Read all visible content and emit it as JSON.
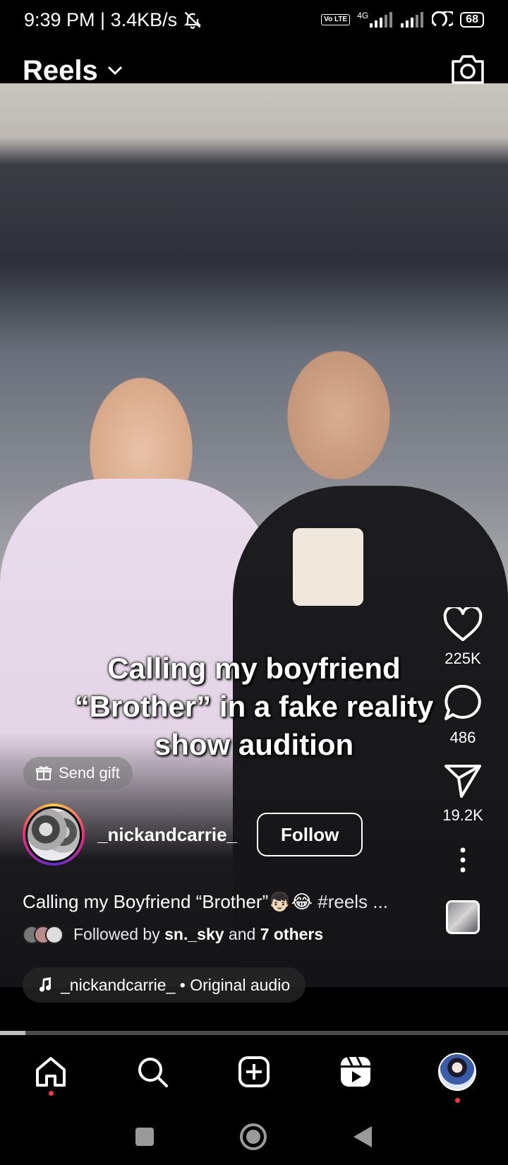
{
  "status_bar": {
    "time_speed": "9:39 PM | 3.4KB/s",
    "network": "4G",
    "volte": "Vo LTE",
    "battery": "68"
  },
  "header": {
    "title": "Reels"
  },
  "video": {
    "caption_overlay": "Calling my boyfriend “Brother” in a fake reality show audition"
  },
  "actions": {
    "likes": "225K",
    "comments": "486",
    "shares": "19.2K"
  },
  "gift": {
    "label": "Send gift"
  },
  "post": {
    "username": "_nickandcarrie_",
    "follow_label": "Follow",
    "description": "Calling my Boyfriend “Brother”👦🏻😂",
    "hashtag": "#reels ...",
    "followed_prefix": "Followed by",
    "followed_user": "sn._sky",
    "followed_middle": "and",
    "followed_others": "7 others",
    "audio": "_nickandcarrie_ • Original audio"
  },
  "progress": {
    "fraction": 0.05
  },
  "colors": {
    "background": "#000000",
    "notification_dot": "#ff3040"
  }
}
